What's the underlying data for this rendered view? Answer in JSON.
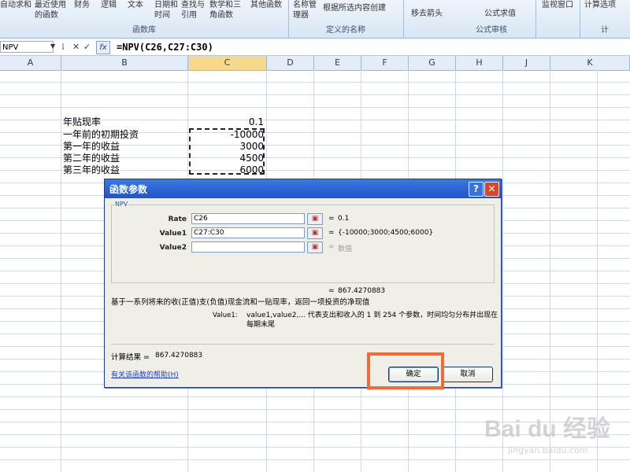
{
  "ribbon": {
    "buttons": [
      "自动求和",
      "最近使用的函数",
      "财务",
      "逻辑",
      "文本",
      "日期和时间",
      "查找与引用",
      "数学和三角函数",
      "其他函数",
      "名称管理器",
      "根据所选内容创建",
      "移去箭头",
      "公式求值",
      "监视窗口",
      "计算选项"
    ],
    "groups": [
      "函数库",
      "定义的名称",
      "公式审核",
      "计"
    ]
  },
  "formula_bar": {
    "name_box": "NPV",
    "formula": "=NPV(C26,C27:C30)"
  },
  "columns": [
    "A",
    "B",
    "C",
    "D",
    "E",
    "F",
    "G",
    "H",
    "J",
    "K"
  ],
  "cells": {
    "labels": [
      "年贴现率",
      "一年前的初期投资",
      "第一年的收益",
      "第二年的收益",
      "第三年的收益"
    ],
    "values": [
      "0.1",
      "-10000",
      "3000",
      "4500",
      "6000"
    ]
  },
  "dialog": {
    "title": "函数参数",
    "function_name": "NPV",
    "args": [
      {
        "label": "Rate",
        "value": "C26",
        "result": "0.1"
      },
      {
        "label": "Value1",
        "value": "C27:C30",
        "result": "{-10000;3000;4500;6000}"
      },
      {
        "label": "Value2",
        "value": "",
        "result": "数值"
      }
    ],
    "formula_result": "867.4270883",
    "description": "基于一系列将来的收(正值)支(负值)现金流和一贴现率，返回一项投资的净现值",
    "param_name": "Value1:",
    "param_description": "value1,value2,... 代表支出和收入的 1 到 254 个参数，时间均匀分布并出现在每期末尾",
    "calc_label": "计算结果 =",
    "calc_value": "867.4270883",
    "help_link": "有关该函数的帮助(H)",
    "ok": "确定",
    "cancel": "取消"
  },
  "watermark": {
    "main": "Bai du 经验",
    "sub": "jingyan.baidu.com"
  },
  "colors": {
    "title_bar": "#1f55c8",
    "highlight": "#f26a35",
    "selected_column": "#f8d88a"
  }
}
